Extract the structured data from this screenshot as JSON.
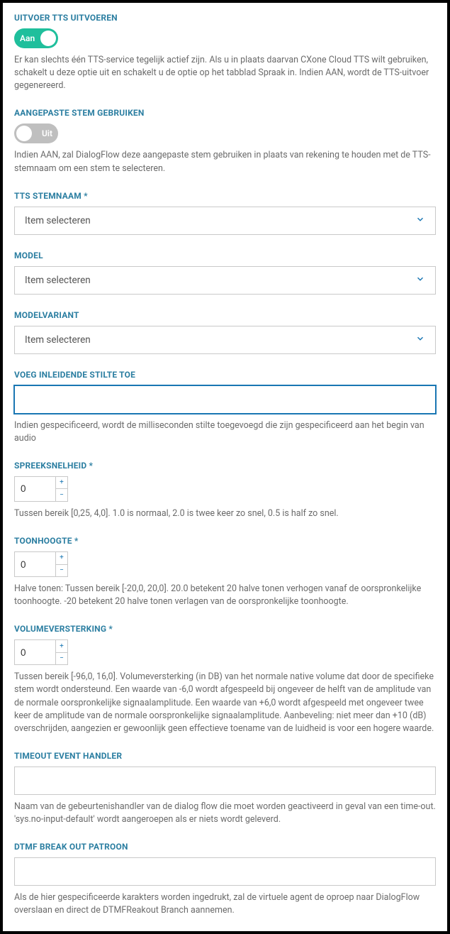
{
  "perform_tts": {
    "label": "UITVOER TTS UITVOEREN",
    "toggle_on_text": "Aan",
    "help": "Er kan slechts één TTS-service tegelijk actief zijn. Als u in plaats daarvan CXone Cloud TTS wilt gebruiken, schakelt u deze optie uit en schakelt u de optie op het tabblad Spraak in. Indien AAN, wordt de TTS-uitvoer gegenereerd."
  },
  "custom_voice": {
    "label": "AANGEPASTE STEM GEBRUIKEN",
    "toggle_off_text": "Uit",
    "help": "Indien AAN, zal DialogFlow deze aangepaste stem gebruiken in plaats van rekening te houden met de TTS-stemnaam om een stem te selecteren."
  },
  "tts_voice_name": {
    "label": "TTS STEMNAAM *",
    "placeholder": "Item selecteren"
  },
  "model": {
    "label": "MODEL",
    "placeholder": "Item selecteren"
  },
  "model_variant": {
    "label": "MODELVARIANT",
    "placeholder": "Item selecteren"
  },
  "leading_silence": {
    "label": "VOEG INLEIDENDE STILTE TOE",
    "value": "",
    "help": "Indien gespecificeerd, wordt de milliseconden stilte toegevoegd die zijn gespecificeerd aan het begin van audio"
  },
  "speaking_rate": {
    "label": "SPREEKSNELHEID *",
    "value": "0",
    "help": "Tussen bereik [0,25, 4,0]. 1.0 is normaal, 2.0 is twee keer zo snel, 0.5 is half zo snel."
  },
  "pitch": {
    "label": "TOONHOOGTE *",
    "value": "0",
    "help": "Halve tonen: Tussen bereik [-20,0, 20,0]. 20.0 betekent 20 halve tonen verhogen vanaf de oorspronkelijke toonhoogte. -20 betekent 20 halve tonen verlagen van de oorspronkelijke toonhoogte."
  },
  "volume_gain": {
    "label": "VOLUMEVERSTERKING *",
    "value": "0",
    "help": "Tussen bereik [-96,0, 16,0]. Volumeversterking (in DB) van het normale native volume dat door de specifieke stem wordt ondersteund. Een waarde van -6,0 wordt afgespeeld bij ongeveer de helft van de amplitude van de normale oorspronkelijke signaalamplitude. Een waarde van +6,0 wordt afgespeeld met ongeveer twee keer de amplitude van de normale oorspronkelijke signaalamplitude. Aanbeveling: niet meer dan +10 (dB) overschrijden, aangezien er gewoonlijk geen effectieve toename van de luidheid is voor een hogere waarde."
  },
  "timeout_handler": {
    "label": "TIMEOUT EVENT HANDLER",
    "value": "",
    "help": "Naam van de gebeurtenishandler van de dialog flow die moet worden geactiveerd in geval van een time-out. 'sys.no-input-default' wordt aangeroepen als er niets wordt geleverd."
  },
  "dtmf_breakout": {
    "label": "DTMF BREAK OUT PATROON",
    "value": "",
    "help": "Als de hier gespecificeerde karakters worden ingedrukt, zal de virtuele agent de oproep naar DialogFlow overslaan en direct de DTMFReakout Branch aannemen."
  }
}
